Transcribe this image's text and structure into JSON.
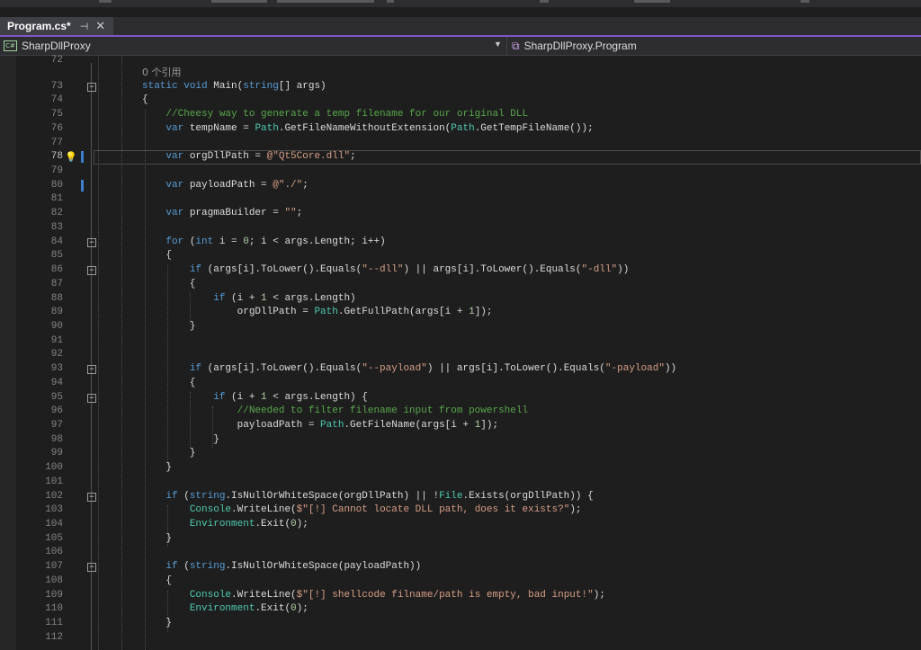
{
  "tab": {
    "title": "Program.cs*",
    "pin": "⊣",
    "close": "✕"
  },
  "nav": {
    "project": "SharpDllProxy",
    "class": "SharpDllProxy.Program",
    "project_icon": "C#"
  },
  "codelens": "0 个引用",
  "lines": [
    {
      "n": "72",
      "html": ""
    },
    {
      "n": "73",
      "html": "<span class=\"kw\">static</span> <span class=\"kw\">void</span> Main(<span class=\"kw\">string</span>[] args)",
      "fold": true
    },
    {
      "n": "74",
      "html": "{"
    },
    {
      "n": "75",
      "html": "    <span class=\"cm\">//Cheesy way to generate a temp filename for our original DLL</span>"
    },
    {
      "n": "76",
      "html": "    <span class=\"kw\">var</span> tempName = <span class=\"ty\">Path</span>.GetFileNameWithoutExtension(<span class=\"ty\">Path</span>.GetTempFileName());"
    },
    {
      "n": "77",
      "html": ""
    },
    {
      "n": "78",
      "html": "    <span class=\"kw\">var</span> orgDllPath = <span class=\"st\">@\"Qt5Core.dll\"</span>;",
      "current": true,
      "bulb": true,
      "changed": true
    },
    {
      "n": "79",
      "html": ""
    },
    {
      "n": "80",
      "html": "    <span class=\"kw\">var</span> payloadPath = <span class=\"st\">@\"./\"</span>;",
      "changed": true
    },
    {
      "n": "81",
      "html": ""
    },
    {
      "n": "82",
      "html": "    <span class=\"kw\">var</span> pragmaBuilder = <span class=\"st\">\"\"</span>;"
    },
    {
      "n": "83",
      "html": ""
    },
    {
      "n": "84",
      "html": "    <span class=\"kw\">for</span> (<span class=\"kw\">int</span> i = <span class=\"nm\">0</span>; i &lt; args.Length; i++)",
      "fold": true
    },
    {
      "n": "85",
      "html": "    {"
    },
    {
      "n": "86",
      "html": "        <span class=\"kw\">if</span> (args[i].ToLower().Equals(<span class=\"st\">\"--dll\"</span>) || args[i].ToLower().Equals(<span class=\"st\">\"-dll\"</span>))",
      "fold": true
    },
    {
      "n": "87",
      "html": "        {"
    },
    {
      "n": "88",
      "html": "            <span class=\"kw\">if</span> (i + <span class=\"nm\">1</span> &lt; args.Length)"
    },
    {
      "n": "89",
      "html": "                orgDllPath = <span class=\"ty\">Path</span>.GetFullPath(args[i + <span class=\"nm\">1</span>]);"
    },
    {
      "n": "90",
      "html": "        }"
    },
    {
      "n": "91",
      "html": ""
    },
    {
      "n": "92",
      "html": ""
    },
    {
      "n": "93",
      "html": "        <span class=\"kw\">if</span> (args[i].ToLower().Equals(<span class=\"st\">\"--payload\"</span>) || args[i].ToLower().Equals(<span class=\"st\">\"-payload\"</span>))",
      "fold": true
    },
    {
      "n": "94",
      "html": "        {"
    },
    {
      "n": "95",
      "html": "            <span class=\"kw\">if</span> (i + <span class=\"nm\">1</span> &lt; args.Length) {",
      "fold": true
    },
    {
      "n": "96",
      "html": "                <span class=\"cm\">//Needed to filter filename input from powershell</span>"
    },
    {
      "n": "97",
      "html": "                payloadPath = <span class=\"ty\">Path</span>.GetFileName(args[i + <span class=\"nm\">1</span>]);"
    },
    {
      "n": "98",
      "html": "            }"
    },
    {
      "n": "99",
      "html": "        }"
    },
    {
      "n": "100",
      "html": "    }"
    },
    {
      "n": "101",
      "html": ""
    },
    {
      "n": "102",
      "html": "    <span class=\"kw\">if</span> (<span class=\"kw\">string</span>.IsNullOrWhiteSpace(orgDllPath) || !<span class=\"ty\">File</span>.Exists(orgDllPath)) {",
      "fold": true
    },
    {
      "n": "103",
      "html": "        <span class=\"ty\">Console</span>.WriteLine(<span class=\"st\">$\"[!] Cannot locate DLL path, does it exists?\"</span>);"
    },
    {
      "n": "104",
      "html": "        <span class=\"ty\">Environment</span>.Exit(<span class=\"nm\">0</span>);"
    },
    {
      "n": "105",
      "html": "    }"
    },
    {
      "n": "106",
      "html": ""
    },
    {
      "n": "107",
      "html": "    <span class=\"kw\">if</span> (<span class=\"kw\">string</span>.IsNullOrWhiteSpace(payloadPath))",
      "fold": true
    },
    {
      "n": "108",
      "html": "    {"
    },
    {
      "n": "109",
      "html": "        <span class=\"ty\">Console</span>.WriteLine(<span class=\"st\">$\"[!] shellcode filname/path is empty, bad input!\"</span>);"
    },
    {
      "n": "110",
      "html": "        <span class=\"ty\">Environment</span>.Exit(<span class=\"nm\">0</span>);"
    },
    {
      "n": "111",
      "html": "    }"
    },
    {
      "n": "112",
      "html": ""
    }
  ]
}
